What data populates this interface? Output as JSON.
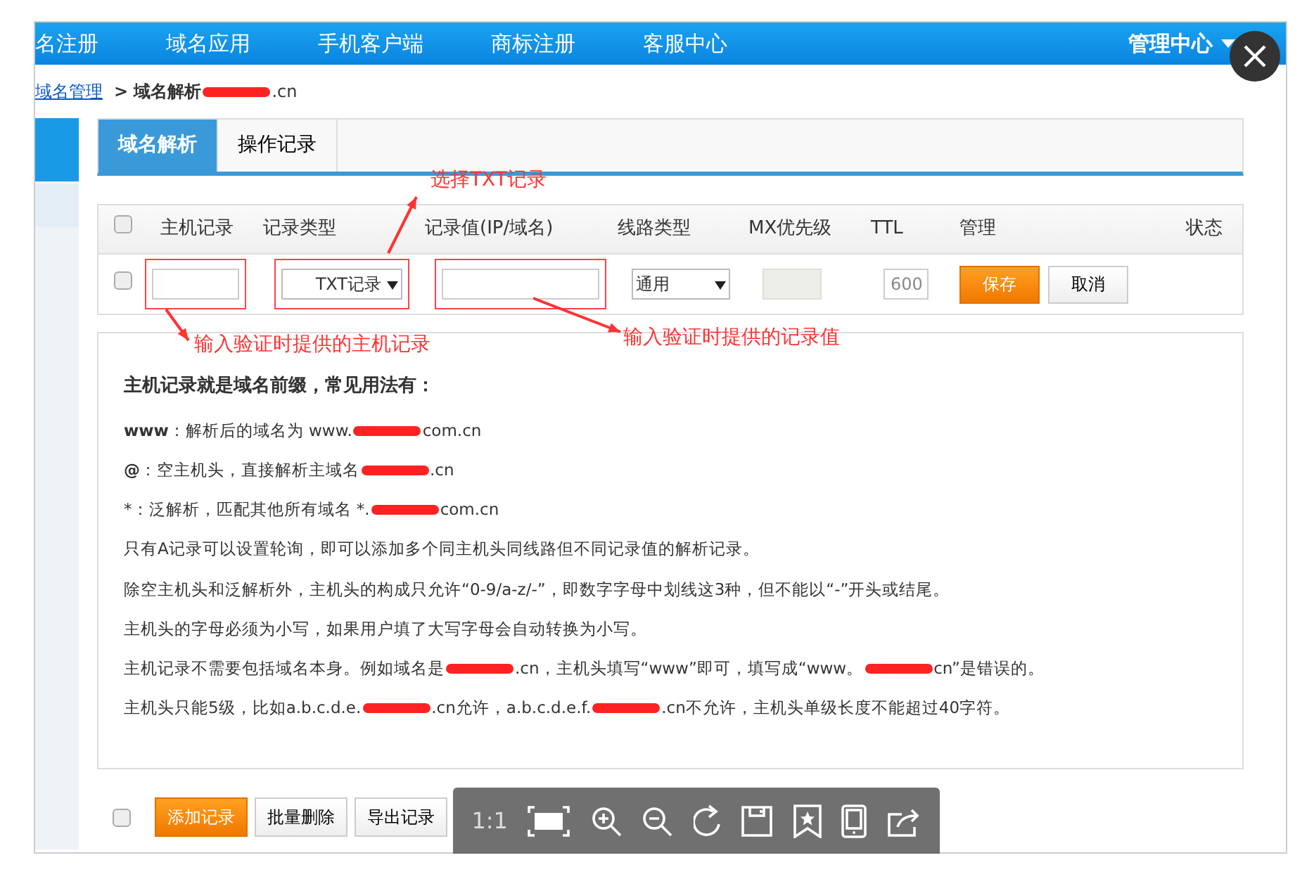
{
  "nav": {
    "items": [
      "名注册",
      "域名应用",
      "手机客户端",
      "商标注册",
      "客服中心"
    ],
    "admin_menu": "管理中心"
  },
  "breadcrumb": {
    "parent": "域名管理",
    "current": "> 域名解析",
    "suffix": ".cn"
  },
  "tabs": [
    {
      "label": "域名解析",
      "selected": true
    },
    {
      "label": "操作记录",
      "selected": false
    }
  ],
  "table": {
    "header_checked": false,
    "columns": [
      "主机记录",
      "记录类型",
      "记录值(IP/域名)",
      "线路类型",
      "MX优先级",
      "TTL",
      "管理",
      "状态"
    ],
    "row": {
      "checked": false,
      "record_type": "TXT记录",
      "line": "通用",
      "mx_disabled": true,
      "ttl": "600",
      "save": "保存",
      "cancel": "取消"
    }
  },
  "annotations": [
    {
      "kind": "type",
      "text": "选择TXT记录"
    },
    {
      "kind": "host",
      "text": "输入验证时提供的主机记录"
    },
    {
      "kind": "value",
      "text": "输入验证时提供的记录值"
    }
  ],
  "help": {
    "title": "主机记录就是域名前缀，常见用法有：",
    "lines": [
      {
        "parts": [
          "**www**：解析后的域名为 www.",
          "com.cn"
        ]
      },
      {
        "parts": [
          "**@**：空主机头，直接解析主域名",
          ".cn"
        ]
      },
      {
        "parts": [
          "*：泛解析，匹配其他所有域名 *.",
          "com.cn"
        ]
      },
      {
        "parts": [
          "只有A记录可以设置轮询，即可以添加多个同主机头同线路但不同记录值的解析记录。"
        ]
      },
      {
        "parts": [
          "除空主机头和泛解析外，主机头的构成只允许“0-9/a-z/-”，即数字字母中划线这3种，但不能以“-”开头或结尾。"
        ]
      },
      {
        "parts": [
          "主机头的字母必须为小写，如果用户填了大写字母会自动转换为小写。"
        ]
      },
      {
        "parts": [
          "主机记录不需要包括域名本身。例如域名是",
          ".cn，主机头填写“www”即可，填写成“www。",
          "cn”是错误的。"
        ]
      },
      {
        "parts": [
          "主机头只能5级，比如a.b.c.d.e.",
          ".cn允许，a.b.c.d.e.f.",
          ".cn不允许，主机头单级长度不能超过40字符。"
        ]
      }
    ]
  },
  "footer": {
    "checked": false,
    "buttons": [
      {
        "kind": "primary",
        "label": "添加记录"
      },
      {
        "kind": "default",
        "label": "批量删除"
      },
      {
        "kind": "default",
        "label": "导出记录"
      }
    ]
  },
  "viewer": {
    "zoom_label": "1:1"
  }
}
